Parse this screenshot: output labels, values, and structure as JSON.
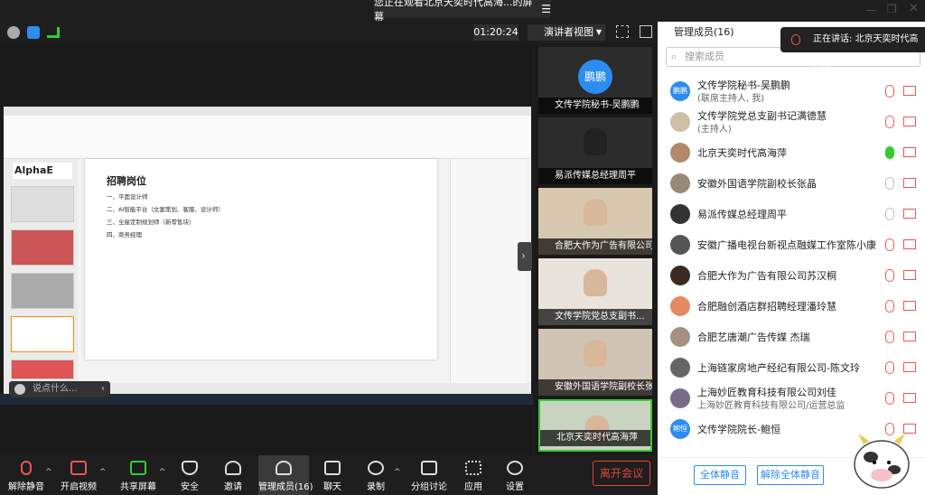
{
  "banner": {
    "text": "您正在观看北京天奕时代高海...的屏幕"
  },
  "timer": "01:20:24",
  "view_mode": "演讲者视图",
  "panel": {
    "title": "管理成员(16)",
    "search_placeholder": "搜索成员",
    "talking": "正在讲话: 北京天奕时代高海..."
  },
  "slide": {
    "title": "招聘岗位",
    "items": [
      "一、平面设计师",
      "二、AI智能平台（文案策划、客服、设计师）",
      "三、全屋定制规划师（新零售块）",
      "四、商务经理"
    ]
  },
  "chat_placeholder": "说点什么...",
  "thumbs": [
    {
      "label": "文传学院秘书-吴鹏鹏",
      "avatar_text": "鹏鹏"
    },
    {
      "label": "易派传媒总经理周平"
    },
    {
      "label": "合肥大作为广告有限公司..."
    },
    {
      "label": "文传学院党总支副书..."
    },
    {
      "label": "安徽外国语学院副校长张晶"
    },
    {
      "label": "北京天奕时代高海萍"
    }
  ],
  "members": [
    {
      "name": "文传学院秘书-吴鹏鹏",
      "sub": "(联席主持人, 我)",
      "avatar": "鹏鹏",
      "color": "#2d8cf0",
      "mic": "muted"
    },
    {
      "name": "文传学院党总支副书记满德慧",
      "sub": "(主持人)",
      "avatar": "",
      "color": "#cdbfa8",
      "mic": "muted"
    },
    {
      "name": "北京天奕时代高海萍",
      "sub": "",
      "avatar": "",
      "color": "#b08a6a",
      "mic": "on"
    },
    {
      "name": "安徽外国语学院副校长张晶",
      "sub": "",
      "avatar": "",
      "color": "#998877",
      "mic": "off"
    },
    {
      "name": "易派传媒总经理周平",
      "sub": "",
      "avatar": "",
      "color": "#333",
      "mic": "off"
    },
    {
      "name": "安徽广播电视台新视点融媒工作室陈小康",
      "sub": "",
      "avatar": "",
      "color": "#555",
      "mic": "muted"
    },
    {
      "name": "合肥大作为广告有限公司苏汉桐",
      "sub": "",
      "avatar": "",
      "color": "#3a2a22",
      "mic": "muted"
    },
    {
      "name": "合肥融创酒店群招聘经理潘玲慧",
      "sub": "",
      "avatar": "",
      "color": "#e58a60",
      "mic": "muted"
    },
    {
      "name": "合肥艺唐潮广告传媒 杰瑞",
      "sub": "",
      "avatar": "",
      "color": "#a89080",
      "mic": "muted"
    },
    {
      "name": "上海链家房地产经纪有限公司-陈文玲",
      "sub": "",
      "avatar": "",
      "color": "#666",
      "mic": "muted"
    },
    {
      "name": "上海妙匠教育科技有限公司刘佳",
      "sub": "上海妙匠教育科技有限公司/运营总监",
      "avatar": "",
      "color": "#7a6a8a",
      "mic": "muted"
    },
    {
      "name": "文传学院院长-鲍恒",
      "sub": "",
      "avatar": "鲍恒",
      "color": "#2d8cf0",
      "mic": "muted"
    }
  ],
  "footer": {
    "mute_all": "全体静音",
    "unmute_all": "解除全体静音"
  },
  "bottom": {
    "unmute": "解除静音",
    "video": "开启视频",
    "share": "共享屏幕",
    "security": "安全",
    "invite": "邀请",
    "members": "管理成员(16)",
    "chat": "聊天",
    "record": "录制",
    "breakout": "分组讨论",
    "apps": "应用",
    "settings": "设置",
    "leave": "离开会议"
  }
}
